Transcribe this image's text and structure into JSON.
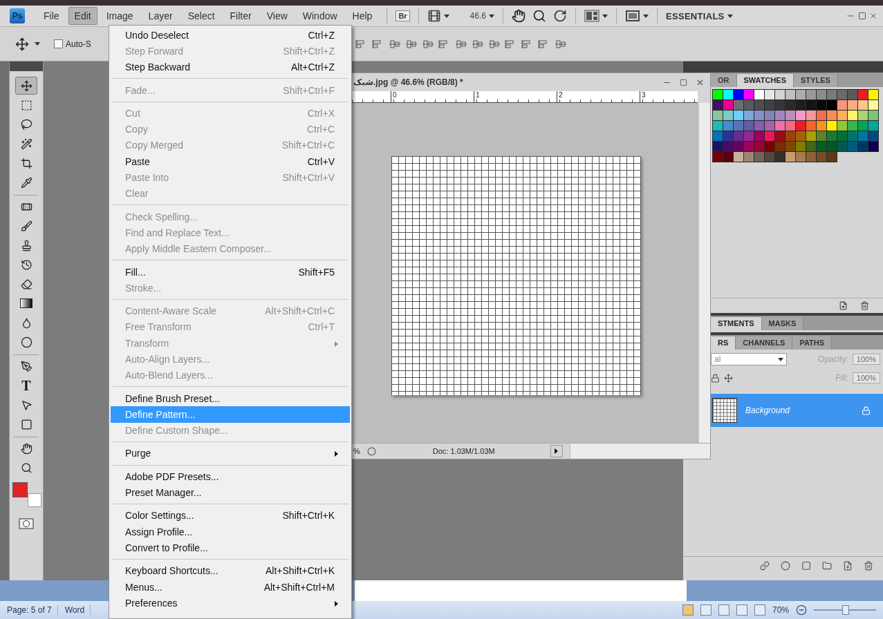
{
  "menubar": {
    "logo": "Ps",
    "menus": [
      {
        "label": "File",
        "selected": false
      },
      {
        "label": "Edit",
        "selected": true
      },
      {
        "label": "Image",
        "selected": false
      },
      {
        "label": "Layer",
        "selected": false
      },
      {
        "label": "Select",
        "selected": false
      },
      {
        "label": "Filter",
        "selected": false
      },
      {
        "label": "View",
        "selected": false
      },
      {
        "label": "Window",
        "selected": false
      },
      {
        "label": "Help",
        "selected": false
      }
    ],
    "bridge": "Br",
    "zoom": "46.6",
    "workspace": "ESSENTIALS"
  },
  "options_bar": {
    "auto_select": {
      "label": "Auto-S",
      "checked": false
    }
  },
  "tools": [
    {
      "kind": "move",
      "selected": true
    },
    {
      "kind": "marquee",
      "selected": false
    },
    {
      "kind": "lasso",
      "selected": false
    },
    {
      "kind": "wand",
      "selected": false
    },
    {
      "kind": "crop",
      "selected": false
    },
    {
      "kind": "eyedropper",
      "selected": false
    },
    {
      "kind": "healing",
      "selected": false
    },
    {
      "kind": "brush",
      "selected": false
    },
    {
      "kind": "stamp",
      "selected": false
    },
    {
      "kind": "history",
      "selected": false
    },
    {
      "kind": "eraser",
      "selected": false
    },
    {
      "kind": "gradient",
      "selected": false
    },
    {
      "kind": "blur",
      "selected": false
    },
    {
      "kind": "dodge",
      "selected": false
    },
    {
      "kind": "pen",
      "selected": false
    },
    {
      "kind": "type",
      "label": "T",
      "selected": false
    },
    {
      "kind": "path",
      "selected": false
    },
    {
      "kind": "shape",
      "selected": false
    },
    {
      "kind": "hand",
      "selected": false
    },
    {
      "kind": "zoom",
      "selected": false
    }
  ],
  "colors": {
    "foreground": {
      "color": "#e02424"
    },
    "background": {
      "color": "#ffffff"
    }
  },
  "edit_menu": {
    "groups": [
      {
        "items": [
          {
            "label": "Undo Deselect",
            "shortcut": "Ctrl+Z",
            "disabled": false,
            "submenu": false,
            "selected": false
          },
          {
            "label": "Step Forward",
            "shortcut": "Shift+Ctrl+Z",
            "disabled": true,
            "submenu": false,
            "selected": false
          },
          {
            "label": "Step Backward",
            "shortcut": "Alt+Ctrl+Z",
            "disabled": false,
            "submenu": false,
            "selected": false
          }
        ]
      },
      {
        "items": [
          {
            "label": "Fade...",
            "shortcut": "Shift+Ctrl+F",
            "disabled": true,
            "submenu": false,
            "selected": false
          }
        ]
      },
      {
        "items": [
          {
            "label": "Cut",
            "shortcut": "Ctrl+X",
            "disabled": true,
            "submenu": false,
            "selected": false
          },
          {
            "label": "Copy",
            "shortcut": "Ctrl+C",
            "disabled": true,
            "submenu": false,
            "selected": false
          },
          {
            "label": "Copy Merged",
            "shortcut": "Shift+Ctrl+C",
            "disabled": true,
            "submenu": false,
            "selected": false
          },
          {
            "label": "Paste",
            "shortcut": "Ctrl+V",
            "disabled": false,
            "submenu": false,
            "selected": false
          },
          {
            "label": "Paste Into",
            "shortcut": "Shift+Ctrl+V",
            "disabled": true,
            "submenu": false,
            "selected": false
          },
          {
            "label": "Clear",
            "disabled": true,
            "submenu": false,
            "selected": false
          }
        ]
      },
      {
        "items": [
          {
            "label": "Check Spelling...",
            "disabled": true,
            "submenu": false,
            "selected": false
          },
          {
            "label": "Find and Replace Text...",
            "disabled": true,
            "submenu": false,
            "selected": false
          },
          {
            "label": "Apply Middle Eastern Composer...",
            "disabled": true,
            "submenu": false,
            "selected": false
          }
        ]
      },
      {
        "items": [
          {
            "label": "Fill...",
            "shortcut": "Shift+F5",
            "disabled": false,
            "submenu": false,
            "selected": false
          },
          {
            "label": "Stroke...",
            "disabled": true,
            "submenu": false,
            "selected": false
          }
        ]
      },
      {
        "items": [
          {
            "label": "Content-Aware Scale",
            "shortcut": "Alt+Shift+Ctrl+C",
            "disabled": true,
            "submenu": false,
            "selected": false
          },
          {
            "label": "Free Transform",
            "shortcut": "Ctrl+T",
            "disabled": true,
            "submenu": false,
            "selected": false
          },
          {
            "label": "Transform",
            "disabled": true,
            "submenu": true,
            "selected": false
          },
          {
            "label": "Auto-Align Layers...",
            "disabled": true,
            "submenu": false,
            "selected": false
          },
          {
            "label": "Auto-Blend Layers...",
            "disabled": true,
            "submenu": false,
            "selected": false
          }
        ]
      },
      {
        "items": [
          {
            "label": "Define Brush Preset...",
            "disabled": false,
            "submenu": false,
            "selected": false
          },
          {
            "label": "Define Pattern...",
            "disabled": false,
            "submenu": false,
            "selected": true
          },
          {
            "label": "Define Custom Shape...",
            "disabled": true,
            "submenu": false,
            "selected": false
          }
        ]
      },
      {
        "items": [
          {
            "label": "Purge",
            "disabled": false,
            "submenu": true,
            "selected": false
          }
        ]
      },
      {
        "items": [
          {
            "label": "Adobe PDF Presets...",
            "disabled": false,
            "submenu": false,
            "selected": false
          },
          {
            "label": "Preset Manager...",
            "disabled": false,
            "submenu": false,
            "selected": false
          }
        ]
      },
      {
        "items": [
          {
            "label": "Color Settings...",
            "shortcut": "Shift+Ctrl+K",
            "disabled": false,
            "submenu": false,
            "selected": false
          },
          {
            "label": "Assign Profile...",
            "disabled": false,
            "submenu": false,
            "selected": false
          },
          {
            "label": "Convert to Profile...",
            "disabled": false,
            "submenu": false,
            "selected": false
          }
        ]
      },
      {
        "items": [
          {
            "label": "Keyboard Shortcuts...",
            "shortcut": "Alt+Shift+Ctrl+K",
            "disabled": false,
            "submenu": false,
            "selected": false
          },
          {
            "label": "Menus...",
            "shortcut": "Alt+Shift+Ctrl+M",
            "disabled": false,
            "submenu": false,
            "selected": false
          },
          {
            "label": "Preferences",
            "disabled": false,
            "submenu": true,
            "selected": false
          }
        ]
      }
    ]
  },
  "document": {
    "title": "شبک.jpg @ 46.6% (RGB/8) *",
    "ruler": [
      "0",
      "1",
      "2",
      "3"
    ],
    "zoom": "%",
    "status": "Doc: 1.03M/1.03M"
  },
  "swatches_panel": {
    "tabs": [
      {
        "label": "OR",
        "selected": false
      },
      {
        "label": "SWATCHES",
        "selected": true
      },
      {
        "label": "STYLES",
        "selected": false
      }
    ],
    "rows": [
      {
        "swatches": [
          {
            "color": "#00ff00"
          },
          {
            "color": "#00ffff"
          },
          {
            "color": "#0000ff"
          },
          {
            "color": "#ff00ff"
          },
          {
            "color": "#ffffff"
          },
          {
            "color": "#e6e6e6"
          },
          {
            "color": "#d4d4d4"
          },
          {
            "color": "#c0c0c0"
          },
          {
            "color": "#acacac"
          },
          {
            "color": "#999999"
          },
          {
            "color": "#8c8c8c"
          },
          {
            "color": "#7a7a7a"
          },
          {
            "color": "#6a6a6a"
          },
          {
            "color": "#5a5a5a"
          },
          {
            "color": "#ed1c24"
          },
          {
            "color": "#fff200"
          }
        ]
      },
      {
        "swatches": [
          {
            "color": "#440e62"
          },
          {
            "color": "#ec008c"
          },
          {
            "color": "#6d6e71"
          },
          {
            "color": "#58595b"
          },
          {
            "color": "#4d4d4d"
          },
          {
            "color": "#414042"
          },
          {
            "color": "#363636"
          },
          {
            "color": "#2b2b2b"
          },
          {
            "color": "#1f1f1f"
          },
          {
            "color": "#141414"
          },
          {
            "color": "#0a0a0a"
          },
          {
            "color": "#000000"
          },
          {
            "color": "#f7977a"
          },
          {
            "color": "#f9ad81"
          },
          {
            "color": "#fdc68a"
          },
          {
            "color": "#fff79a"
          }
        ]
      },
      {
        "swatches": [
          {
            "color": "#82ca9c"
          },
          {
            "color": "#7accc8"
          },
          {
            "color": "#6dcff6"
          },
          {
            "color": "#7da7d9"
          },
          {
            "color": "#8393ca"
          },
          {
            "color": "#8781bd"
          },
          {
            "color": "#a187be"
          },
          {
            "color": "#bc8dbf"
          },
          {
            "color": "#f49ac2"
          },
          {
            "color": "#f6989d"
          },
          {
            "color": "#f26c4f"
          },
          {
            "color": "#f68e56"
          },
          {
            "color": "#fbaf5d"
          },
          {
            "color": "#fff568"
          },
          {
            "color": "#acd373"
          },
          {
            "color": "#7cc576"
          }
        ]
      },
      {
        "swatches": [
          {
            "color": "#1cbbb4"
          },
          {
            "color": "#448ccb"
          },
          {
            "color": "#5674b9"
          },
          {
            "color": "#605ca8"
          },
          {
            "color": "#855fa8"
          },
          {
            "color": "#a763a8"
          },
          {
            "color": "#f06eaa"
          },
          {
            "color": "#f26d7d"
          },
          {
            "color": "#ed1c24"
          },
          {
            "color": "#f26522"
          },
          {
            "color": "#f7941d"
          },
          {
            "color": "#fff200"
          },
          {
            "color": "#8dc63f"
          },
          {
            "color": "#39b54a"
          },
          {
            "color": "#00a651"
          },
          {
            "color": "#00a99d"
          }
        ]
      },
      {
        "swatches": [
          {
            "color": "#0072bc"
          },
          {
            "color": "#2e3192"
          },
          {
            "color": "#662d91"
          },
          {
            "color": "#92278f"
          },
          {
            "color": "#9e005d"
          },
          {
            "color": "#ed145b"
          },
          {
            "color": "#9e0b0f"
          },
          {
            "color": "#a0410d"
          },
          {
            "color": "#a36209"
          },
          {
            "color": "#aba000"
          },
          {
            "color": "#598527"
          },
          {
            "color": "#197b30"
          },
          {
            "color": "#007236"
          },
          {
            "color": "#00746b"
          },
          {
            "color": "#0076a3"
          },
          {
            "color": "#004a80"
          }
        ]
      },
      {
        "swatches": [
          {
            "color": "#1b1464"
          },
          {
            "color": "#440e62"
          },
          {
            "color": "#630460"
          },
          {
            "color": "#9e005d"
          },
          {
            "color": "#9e0039"
          },
          {
            "color": "#790000"
          },
          {
            "color": "#7b2e00"
          },
          {
            "color": "#7d4900"
          },
          {
            "color": "#827b00"
          },
          {
            "color": "#406618"
          },
          {
            "color": "#005e20"
          },
          {
            "color": "#005826"
          },
          {
            "color": "#005952"
          },
          {
            "color": "#005b7f"
          },
          {
            "color": "#003663"
          },
          {
            "color": "#0d004c"
          }
        ]
      },
      {
        "swatches": [
          {
            "color": "#790000"
          },
          {
            "color": "#5a0010"
          },
          {
            "color": "#c7b299"
          },
          {
            "color": "#998675"
          },
          {
            "color": "#736357"
          },
          {
            "color": "#534741"
          },
          {
            "color": "#362f2d"
          },
          {
            "color": "#c69c6d"
          },
          {
            "color": "#a67c52"
          },
          {
            "color": "#8c6239"
          },
          {
            "color": "#754c24"
          },
          {
            "color": "#603913"
          }
        ]
      }
    ]
  },
  "adjustments_panel": {
    "tabs": [
      {
        "label": "STMENTS",
        "selected": true
      },
      {
        "label": "MASKS",
        "selected": false
      }
    ]
  },
  "layers_panel": {
    "tabs": [
      {
        "label": "RS",
        "selected": true
      },
      {
        "label": "CHANNELS",
        "selected": false
      },
      {
        "label": "PATHS",
        "selected": false
      }
    ],
    "blend_mode": "al",
    "opacity_label": "Opacity:",
    "opacity": "100%",
    "fill_label": "Fill:",
    "fill": "100%",
    "layers": [
      {
        "name": "Background",
        "selected": true,
        "locked": true
      }
    ]
  },
  "word_status": {
    "page": "Page: 5 of 7",
    "words": "Word",
    "views": [
      {
        "selected": true
      },
      {
        "selected": false
      },
      {
        "selected": false
      },
      {
        "selected": false
      },
      {
        "selected": false
      }
    ],
    "zoom": "70%",
    "level": 0.5
  }
}
